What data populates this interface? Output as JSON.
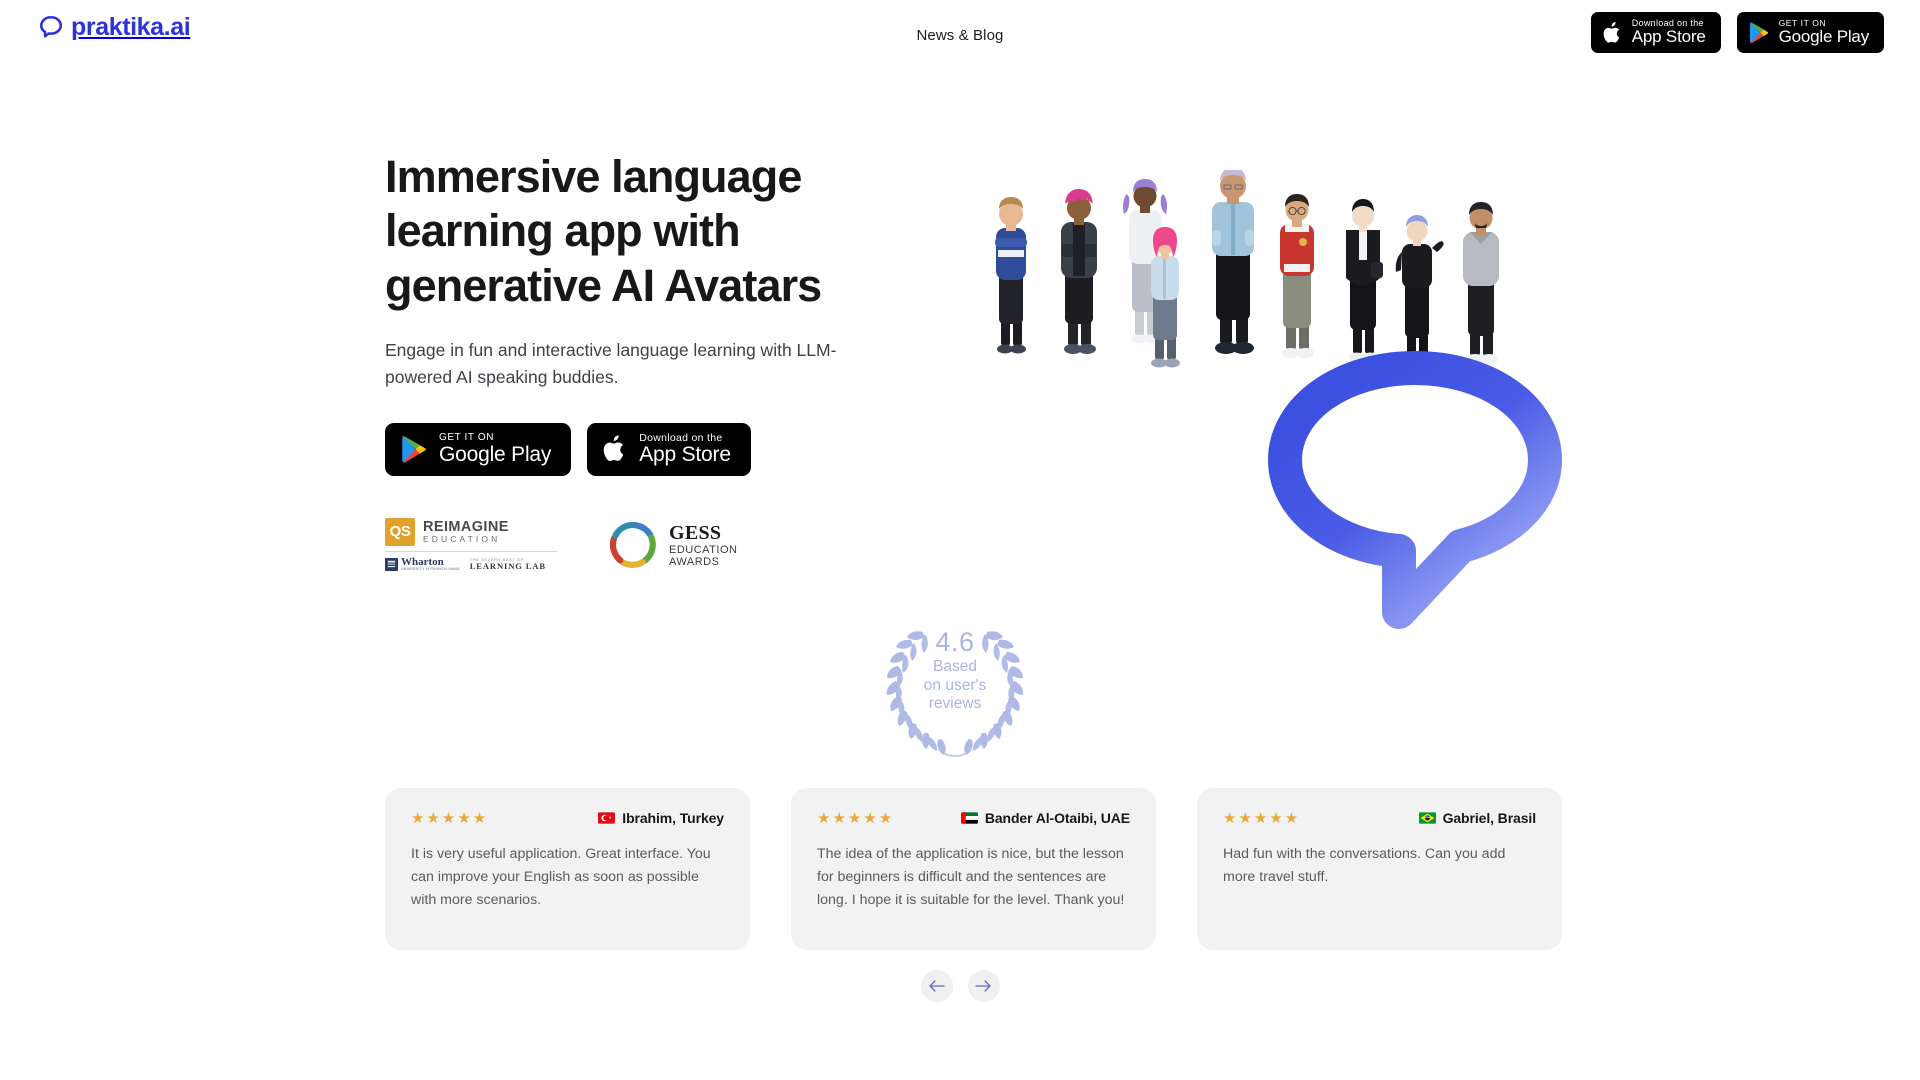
{
  "brand": {
    "name": "praktika.ai",
    "logo_icon": "speech-bubble-logo-icon",
    "accent_color": "#2B32DE",
    "bubble_gradient_from": "#3B4FE0",
    "bubble_gradient_to": "#9AA7F2"
  },
  "header": {
    "nav": [
      {
        "label": "News & Blog"
      }
    ],
    "badges": [
      {
        "store": "app-store",
        "small_label": "Download on the",
        "large_label": "App Store",
        "icon": "apple-icon"
      },
      {
        "store": "google-play",
        "small_label": "GET IT ON",
        "large_label": "Google Play",
        "icon": "google-play-icon"
      }
    ]
  },
  "hero": {
    "title": "Immersive language learning app with generative AI Avatars",
    "subtitle": "Engage in fun and interactive language learning with LLM-powered AI speaking buddies.",
    "ctas": [
      {
        "store": "google-play",
        "small_label": "GET IT ON",
        "large_label": "Google Play",
        "icon": "google-play-icon"
      },
      {
        "store": "app-store",
        "small_label": "Download on the",
        "large_label": "App Store",
        "icon": "apple-icon"
      }
    ],
    "awards": {
      "qs": {
        "mark": "QS",
        "line1": "REIMAGINE",
        "line2": "EDUCATION",
        "partner_name": "Wharton",
        "partner_sub": "UNIVERSITY of PENNSYLVANIA",
        "lab_top": "THE SEVERN BEST OF",
        "lab_main": "LEARNING LAB",
        "mark_color": "#E2A12B"
      },
      "gess": {
        "line1": "GESS",
        "line2": "EDUCATION",
        "line3": "AWARDS",
        "ring_colors": [
          "#3E7FC1",
          "#5CA83C",
          "#E2B230",
          "#C8432F",
          "#2F8FA8"
        ]
      }
    },
    "art": {
      "avatars_alt": "group-of-nine-3d-ai-avatars",
      "bubble_alt": "speech-bubble-graphic"
    }
  },
  "rating": {
    "score": "4.6",
    "line1": "Based",
    "line2": "on user's",
    "line3": "reviews",
    "laurel_color": "#AEB9E6",
    "text_color": "#A9B4E3"
  },
  "testimonials": {
    "star_color": "#E8A93C",
    "cards": [
      {
        "stars": "★★★★★",
        "rating": 5,
        "flag": "turkey-flag",
        "flag_colors": [
          "#E30A17",
          "#ffffff"
        ],
        "author": "Ibrahim, Turkey",
        "text": "It is very useful application. Great interface. You can improve your English as soon as possible with more scenarios."
      },
      {
        "stars": "★★★★★",
        "rating": 5,
        "flag": "uae-flag",
        "flag_colors": [
          "#00732F",
          "#ffffff",
          "#000000",
          "#FF0000"
        ],
        "author": "Bander Al-Otaibi, UAE",
        "text": "The idea of the application is nice, but the lesson for beginners is difficult and the sentences are long. I hope it is suitable for the level. Thank you!"
      },
      {
        "stars": "★★★★★",
        "rating": 5,
        "flag": "brazil-flag",
        "flag_colors": [
          "#009739",
          "#FEDD00",
          "#012169"
        ],
        "author": "Gabriel, Brasil",
        "text": "Had fun with the conversations. Can you add more travel stuff."
      }
    ],
    "nav": {
      "prev_icon": "arrow-left-icon",
      "next_icon": "arrow-right-icon",
      "arrow_color": "#5C6BC8"
    }
  }
}
